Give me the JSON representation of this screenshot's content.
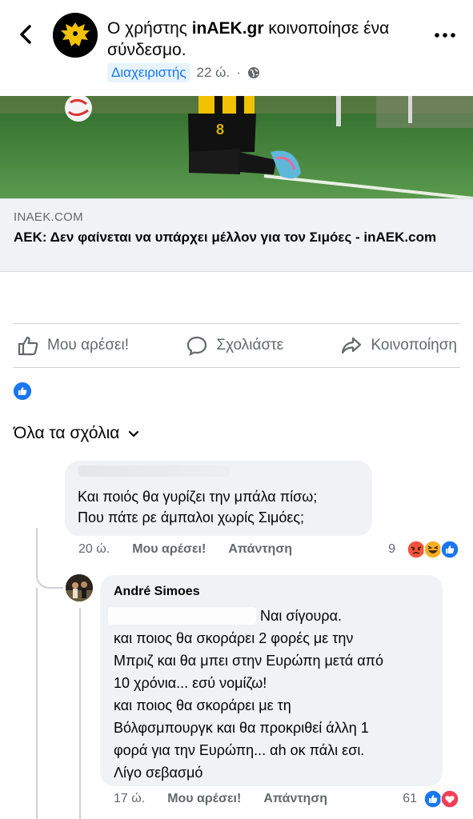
{
  "post": {
    "header_prefix": "Ο χρήστης ",
    "author": "inAEK.gr",
    "header_suffix": " κοινοποίησε ένα σύνδεσμο.",
    "badge": "Διαχειριστής",
    "time": "22 ώ.",
    "separator": "·"
  },
  "link": {
    "domain": "INAEK.COM",
    "title": "ΑΕΚ: Δεν φαίνεται να υπάρχει μέλλον για τον Σιμόες - inAEK.com",
    "image_shirt_number": "8"
  },
  "actions": {
    "like": "Μου αρέσει!",
    "comment": "Σχολιάστε",
    "share": "Κοινοποίηση"
  },
  "comments_header": "Όλα τα σχόλια",
  "comment1": {
    "line1": "Και ποιός θα γυρίζει την μπάλα πίσω;",
    "line2": "Που πάτε ρε άμπαλοι χωρίς Σιμόες;",
    "time": "20 ώ.",
    "like": "Μου αρέσει!",
    "reply": "Απάντηση",
    "reactions_count": "9"
  },
  "comment2": {
    "author": "André Simoes",
    "mention_rest": "Ναι σίγουρα.",
    "line1": "και ποιος θα σκοράρει 2 φορές με την",
    "line2": "Μπριζ και θα μπει στην Ευρώπη μετά από",
    "line3": "10 χρόνια... εσύ νομίζω!",
    "line4": "και ποιος θα σκοράρει με τη",
    "line5": "Βόλφσμπουργκ και θα προκριθεί άλλη 1",
    "line6": "φορά για την Ευρώπη... αh οκ πάλι εσι.",
    "line7": "Λίγο σεβασμό",
    "time": "17 ώ.",
    "like": "Μου αρέσει!",
    "reply": "Απάντηση",
    "reactions_count": "61"
  },
  "colors": {
    "facebook_blue": "#1877f2",
    "secondary_text": "#65676b",
    "bubble": "#f0f2f5",
    "love_red": "#f33e58",
    "angry_orange": "#f5533d",
    "haha_yellow": "#f7b125"
  }
}
